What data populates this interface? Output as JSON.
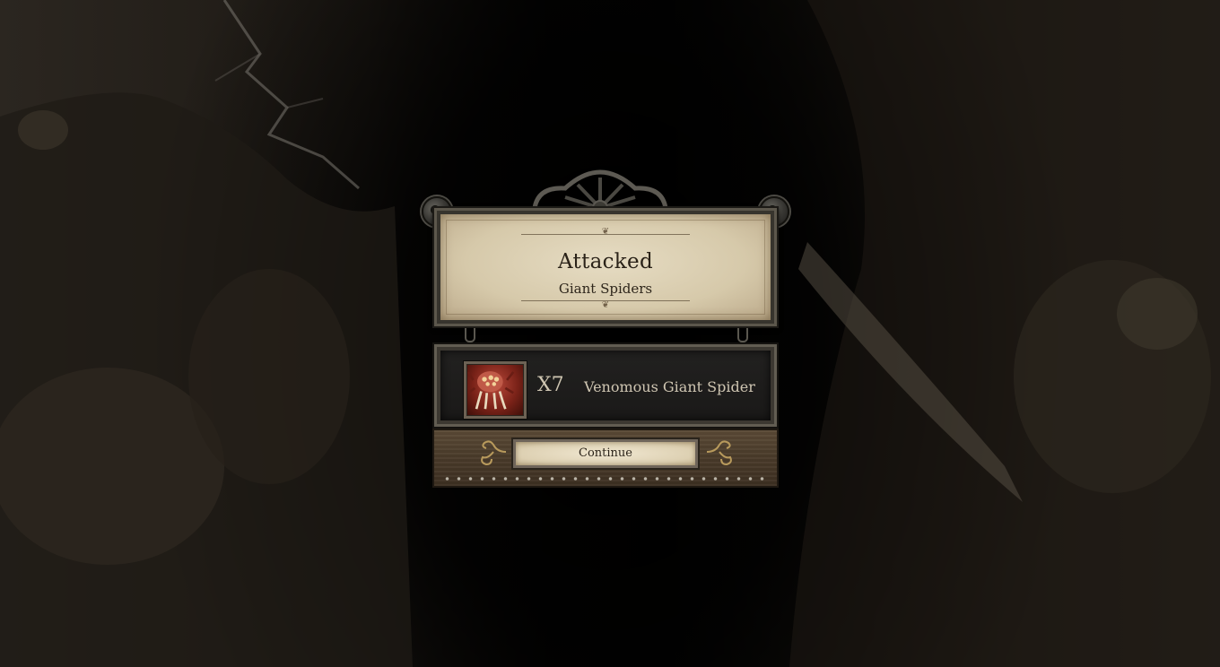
{
  "dialog": {
    "title": "Attacked",
    "subtitle": "Giant Spiders",
    "unit": {
      "count": "X7",
      "name": "Venomous Giant Spider",
      "portrait_icon": "spider-portrait-icon"
    },
    "continue_label": "Continue"
  },
  "colors": {
    "parchment": "#e6dcc3",
    "ink": "#2a2218",
    "unit_text": "#cfc6b2",
    "wood": "#4a3b2a"
  }
}
